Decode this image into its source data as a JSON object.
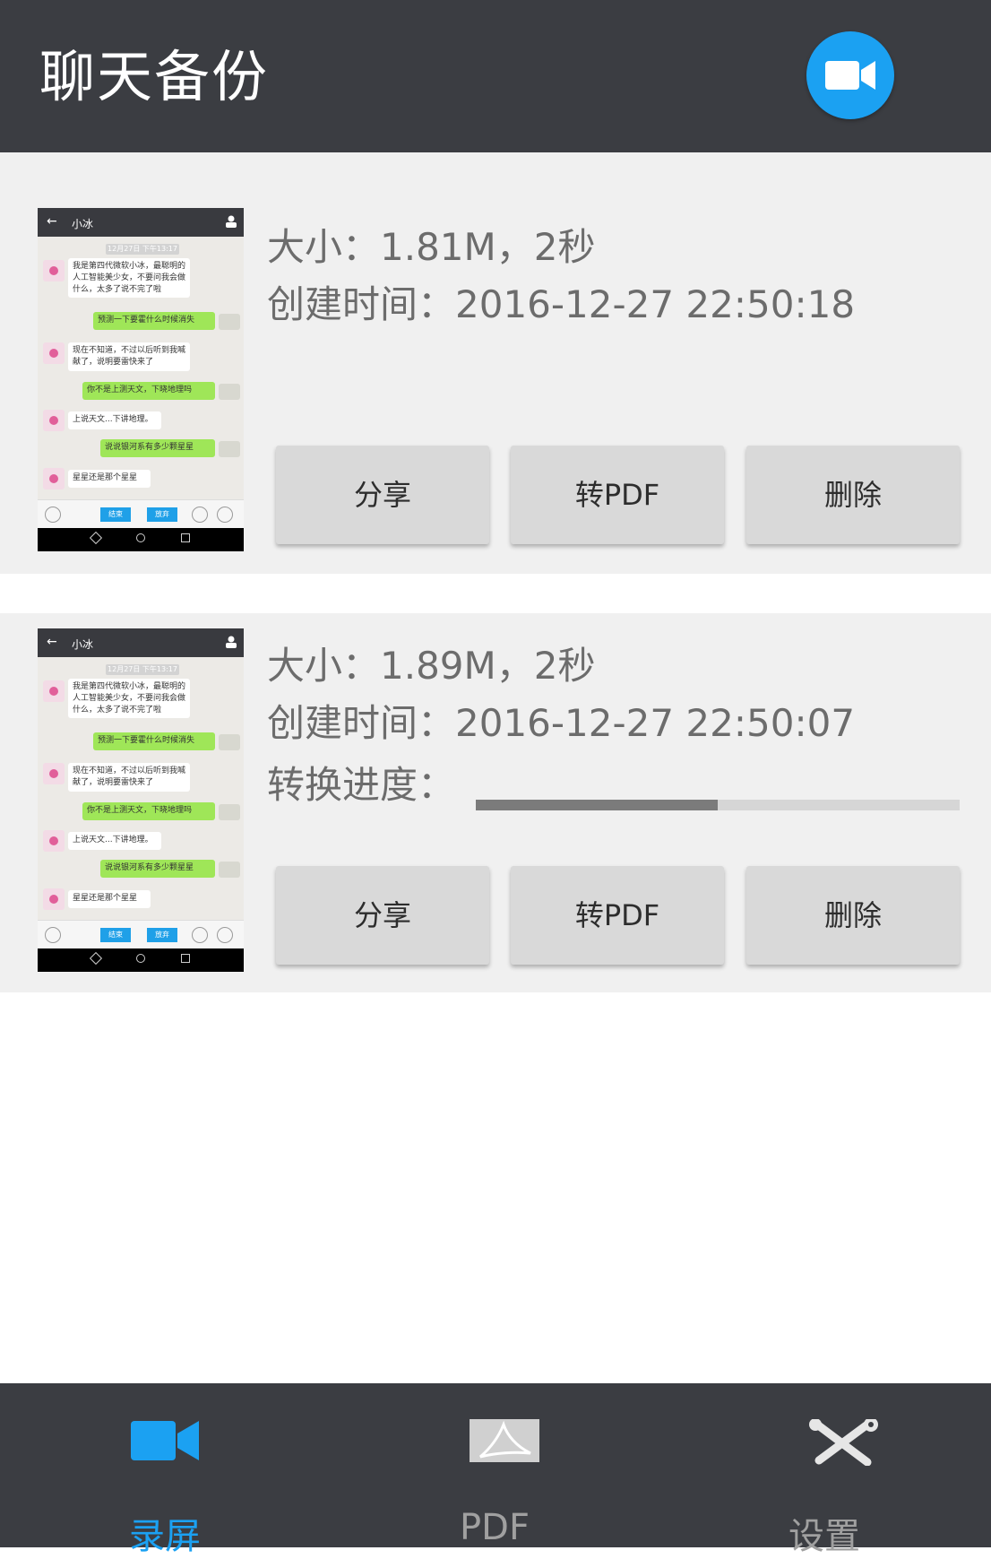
{
  "header": {
    "title": "聊天备份",
    "record_button": "video-camera-icon"
  },
  "recordings": [
    {
      "size_text": "大小：1.81M，2秒",
      "created_text": "创建时间：2016-12-27 22:50:18",
      "actions": {
        "share": "分享",
        "to_pdf": "转PDF",
        "delete": "删除"
      }
    },
    {
      "size_text": "大小：1.89M，2秒",
      "created_text": "创建时间：2016-12-27 22:50:07",
      "progress_label": "转换进度：",
      "progress": 0.5,
      "actions": {
        "share": "分享",
        "to_pdf": "转PDF",
        "delete": "删除"
      }
    }
  ],
  "thumbnail": {
    "contact": "小冰",
    "time": "12月27日 下午13:17",
    "messages": [
      "我是第四代微软小冰，最聪明的人工智能美少女，不要问我会做什么，太多了说不完了啦",
      "预测一下要霍什么时候消失",
      "现在不知道，不过以后听到我喊献了，说明要雷快来了",
      "你不是上测天文，下晓地理吗",
      "上说天文...下讲地理。",
      "说说银河系有多少颗星星",
      "星星还是那个星星"
    ],
    "input_buttons": [
      "结束",
      "放弃"
    ]
  },
  "bottom_nav": {
    "tabs": [
      {
        "label": "录屏",
        "icon": "video-camera-icon",
        "active": true
      },
      {
        "label": "PDF",
        "icon": "pdf-icon",
        "active": false
      },
      {
        "label": "设置",
        "icon": "tools-icon",
        "active": false
      }
    ]
  },
  "colors": {
    "accent": "#1ba1f2",
    "bar": "#3b3d42",
    "card": "#f0f0f0"
  }
}
